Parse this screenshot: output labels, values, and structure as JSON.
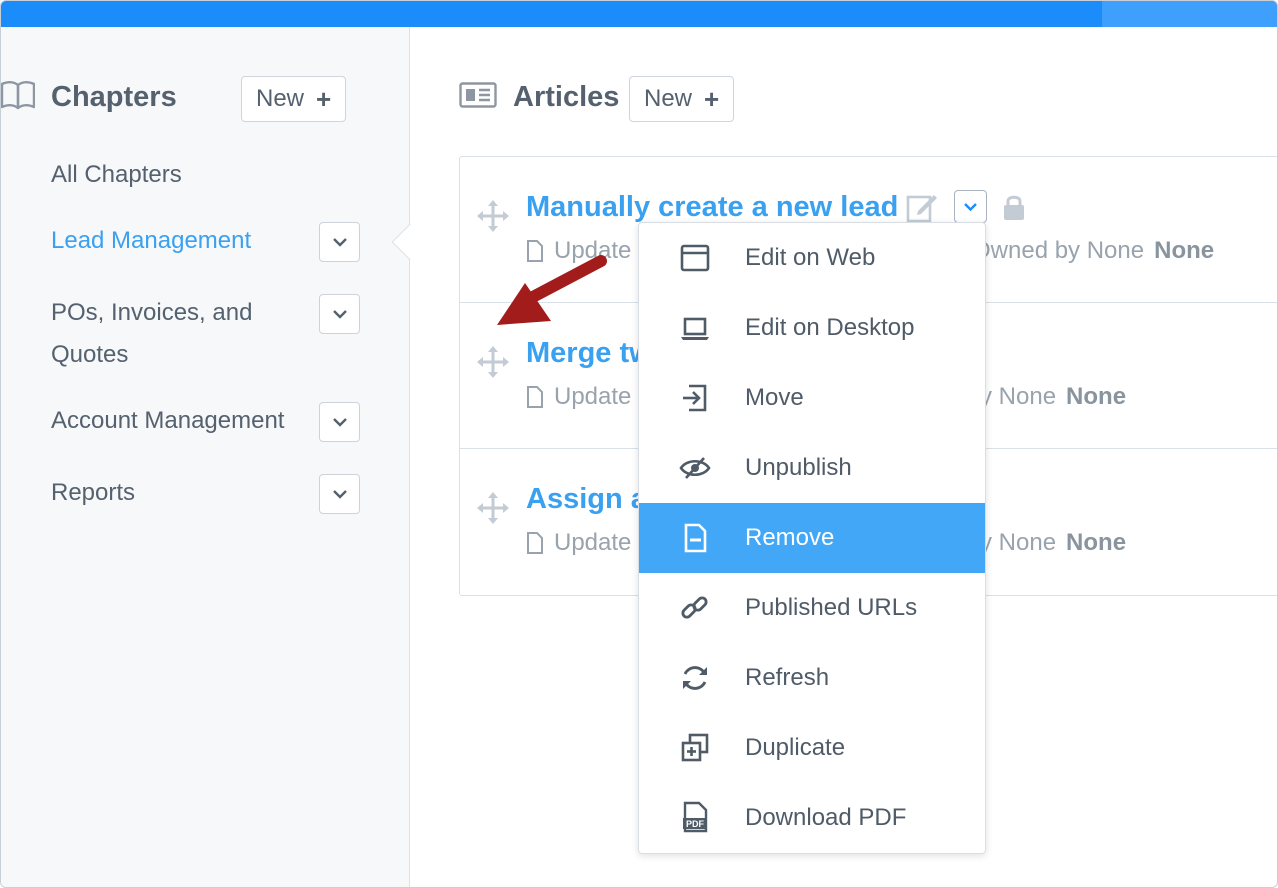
{
  "sidebar": {
    "title": "Chapters",
    "new_label": "New",
    "items": [
      {
        "label": "All Chapters",
        "active": false
      },
      {
        "label": "Lead Management",
        "active": true
      },
      {
        "label": "POs, Invoices, and",
        "label2": "Quotes",
        "active": false
      },
      {
        "label": "Account Management",
        "active": false
      },
      {
        "label": "Reports",
        "active": false
      }
    ]
  },
  "articles": {
    "title": "Articles",
    "new_label": "New",
    "rows": [
      {
        "title": "Manually create a new lead",
        "updated": "Update",
        "owner": "Owned by None",
        "owner_value": "None"
      },
      {
        "title": "Merge tw",
        "updated": "Update",
        "owner": "y None",
        "owner_value": "None"
      },
      {
        "title": "Assign a",
        "updated": "Update",
        "owner": "y None",
        "owner_value": "None"
      }
    ]
  },
  "menu": {
    "items": [
      {
        "label": "Edit on Web",
        "icon": "browser-window-icon"
      },
      {
        "label": "Edit on Desktop",
        "icon": "laptop-icon"
      },
      {
        "label": "Move",
        "icon": "move-in-icon"
      },
      {
        "label": "Unpublish",
        "icon": "eye-slash-icon"
      },
      {
        "label": "Remove",
        "icon": "document-minus-icon",
        "selected": true
      },
      {
        "label": "Published URLs",
        "icon": "link-icon"
      },
      {
        "label": "Refresh",
        "icon": "refresh-icon"
      },
      {
        "label": "Duplicate",
        "icon": "duplicate-icon"
      },
      {
        "label": "Download PDF",
        "icon": "pdf-icon",
        "badge": "PDF"
      }
    ]
  },
  "colors": {
    "topbar": "#1a8dfb",
    "accent": "#3aa0f0",
    "selected_menu": "#42a7f7",
    "annotation_arrow": "#a31c1c"
  }
}
